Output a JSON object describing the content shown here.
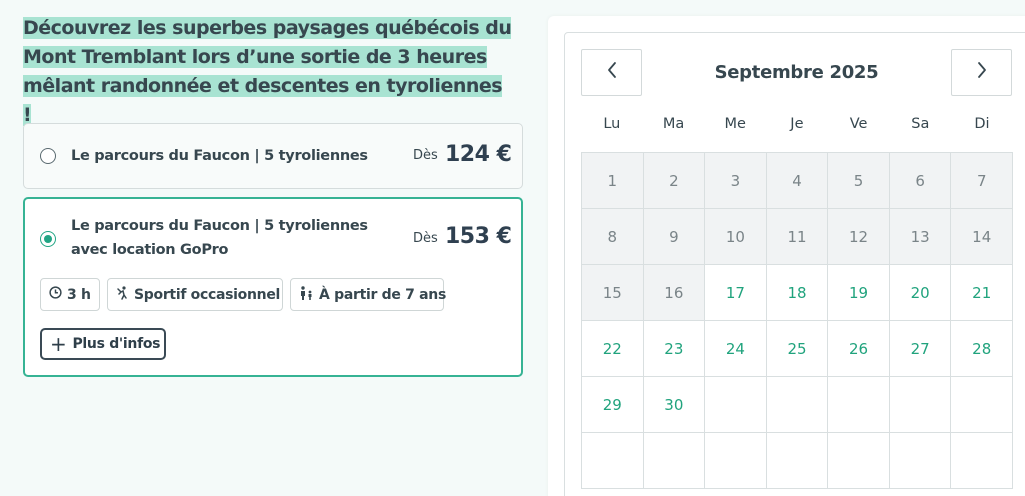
{
  "intro": "Découvrez les superbes paysages québécois du Mont Tremblant lors d’une sortie de 3 heures mêlant randonnée et descentes en tyroliennes !",
  "options": [
    {
      "name": "Le parcours du Faucon | 5 tyroliennes",
      "price_prefix": "Dès",
      "price": "124 €",
      "selected": false
    },
    {
      "name": "Le parcours du Faucon | 5 tyroliennes avec location GoPro",
      "price_prefix": "Dès",
      "price": "153 €",
      "selected": true,
      "tags": [
        {
          "icon": "clock-icon",
          "label": "3 h"
        },
        {
          "icon": "athlete-icon",
          "label": "Sportif occasionnel"
        },
        {
          "icon": "family-icon",
          "label": "À partir de 7 ans"
        }
      ],
      "more_label": "Plus d'infos"
    }
  ],
  "calendar": {
    "month_label": "Septembre 2025",
    "prev_icon": "chevron-left-icon",
    "next_icon": "chevron-right-icon",
    "weekdays": [
      "Lu",
      "Ma",
      "Me",
      "Je",
      "Ve",
      "Sa",
      "Di"
    ],
    "days": [
      {
        "label": "1",
        "state": "past"
      },
      {
        "label": "2",
        "state": "past"
      },
      {
        "label": "3",
        "state": "past"
      },
      {
        "label": "4",
        "state": "past"
      },
      {
        "label": "5",
        "state": "past"
      },
      {
        "label": "6",
        "state": "past"
      },
      {
        "label": "7",
        "state": "past"
      },
      {
        "label": "8",
        "state": "past"
      },
      {
        "label": "9",
        "state": "past"
      },
      {
        "label": "10",
        "state": "past"
      },
      {
        "label": "11",
        "state": "past"
      },
      {
        "label": "12",
        "state": "past"
      },
      {
        "label": "13",
        "state": "past"
      },
      {
        "label": "14",
        "state": "past"
      },
      {
        "label": "15",
        "state": "past"
      },
      {
        "label": "16",
        "state": "past"
      },
      {
        "label": "17",
        "state": "available"
      },
      {
        "label": "18",
        "state": "available"
      },
      {
        "label": "19",
        "state": "available"
      },
      {
        "label": "20",
        "state": "available"
      },
      {
        "label": "21",
        "state": "available"
      },
      {
        "label": "22",
        "state": "available"
      },
      {
        "label": "23",
        "state": "available"
      },
      {
        "label": "24",
        "state": "available"
      },
      {
        "label": "25",
        "state": "available"
      },
      {
        "label": "26",
        "state": "available"
      },
      {
        "label": "27",
        "state": "available"
      },
      {
        "label": "28",
        "state": "available"
      },
      {
        "label": "29",
        "state": "available"
      },
      {
        "label": "30",
        "state": "available"
      }
    ],
    "total_cells": 42
  },
  "colors": {
    "accent": "#36b394",
    "available_day": "#20a37d",
    "highlight": "#a8e3d2"
  }
}
